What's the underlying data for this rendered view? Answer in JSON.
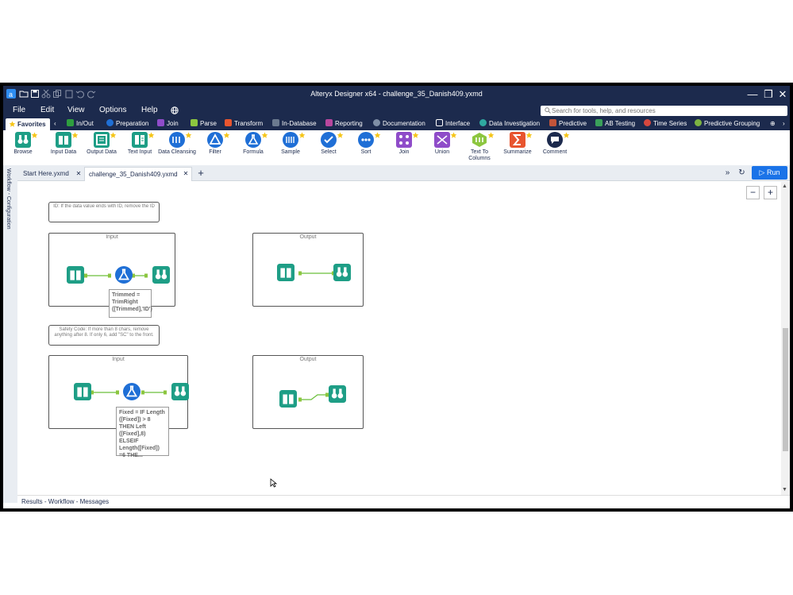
{
  "window": {
    "title": "Alteryx Designer x64 - challenge_35_Danish409.yxmd"
  },
  "menu": [
    "File",
    "Edit",
    "View",
    "Options",
    "Help"
  ],
  "search": {
    "placeholder": "Search for tools, help, and resources"
  },
  "categories": {
    "favorites": "Favorites",
    "items": [
      "In/Out",
      "Preparation",
      "Join",
      "Parse",
      "Transform",
      "In-Database",
      "Reporting",
      "Documentation",
      "Interface",
      "Data Investigation",
      "Predictive",
      "AB Testing",
      "Time Series",
      "Predictive Grouping"
    ],
    "colors": [
      "#2e9e3f",
      "#1f6fd6",
      "#8f4cc9",
      "#8cc63f",
      "#e8552f",
      "#6b7a8f",
      "#b8479e",
      "#7f8fa6",
      "#ffffff",
      "#2fa9a0",
      "#c2543a",
      "#3aa05a",
      "#d6473e",
      "#7cb342"
    ]
  },
  "tools": {
    "browse": "Browse",
    "input_data": "Input Data",
    "output_data": "Output Data",
    "text_input": "Text Input",
    "data_cleansing": "Data Cleansing",
    "filter": "Filter",
    "formula": "Formula",
    "sample": "Sample",
    "select": "Select",
    "sort": "Sort",
    "join": "Join",
    "union": "Union",
    "text_to_columns": "Text To Columns",
    "summarize": "Summarize",
    "comment": "Comment"
  },
  "tabs": {
    "start": "Start Here.yxmd",
    "active": "challenge_35_Danish409.yxmd"
  },
  "run_label": "Run",
  "side_panel": "Workflow - Configuration",
  "canvas": {
    "comment1": "ID: If the data value ends with ID, remove the ID",
    "comment2": "Safety Code: If more than 8 chars, remove anything after 8. If only 6, add \"SC\" to the front.",
    "input_label": "Input",
    "output_label": "Output",
    "anno1": "Trimmed = TrimRight ([Trimmed],'ID')",
    "anno2": "Fixed = IF Length ([Fixed]) > 8 THEN Left ([Fixed],8) ELSEIF Length([Fixed]) =6 THE..."
  },
  "bottom": "Results - Workflow - Messages"
}
